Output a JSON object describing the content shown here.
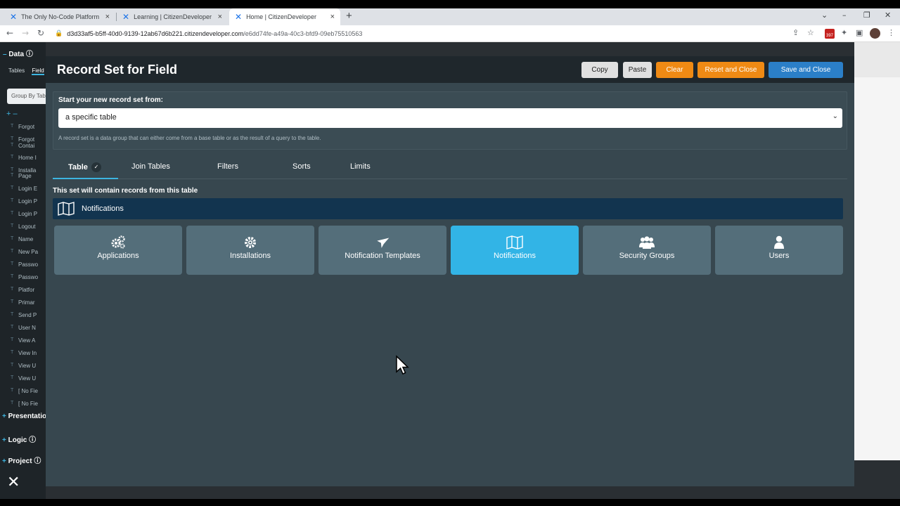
{
  "browser": {
    "tabs": [
      {
        "title": "The Only No-Code Platform For F"
      },
      {
        "title": "Learning | CitizenDeveloper"
      },
      {
        "title": "Home | CitizenDeveloper",
        "active": true
      }
    ],
    "url_host": "d3d33af5-b5ff-40d0-9139-12ab67d6b221.citizendeveloper.com",
    "url_path": "/e6dd74fe-a49a-40c3-bfd9-09eb75510563",
    "extension_badge": "397"
  },
  "left_panel": {
    "data_header": "Data",
    "tabs_label": "Tables",
    "fields_label": "Field",
    "group_by": "Group By Tab",
    "items": [
      "Forgot",
      "Forgot",
      "Contai",
      "Home I",
      "Installa",
      "Page",
      "Login E",
      "Login P",
      "Login P",
      "Logout",
      "Name",
      "New Pa",
      "Passwo",
      "Passwo",
      "Platfor",
      "Primar",
      "Send P",
      "User N",
      "View A",
      "View In",
      "View U",
      "View U",
      "[ No Fie",
      "[ No Fie"
    ],
    "presentation_label": "Presentatio",
    "logic_label": "Logic",
    "project_label": "Project"
  },
  "modal": {
    "title": "Record Set for Field",
    "buttons": {
      "copy": "Copy",
      "paste": "Paste",
      "clear": "Clear",
      "reset": "Reset and Close",
      "save": "Save and Close"
    },
    "source": {
      "label": "Start your new record set from:",
      "selected": "a specific table",
      "help": "A record set is a data group that can either come from a base table or as the result of a query to the table."
    },
    "tabs": [
      {
        "label": "Table",
        "active": true
      },
      {
        "label": "Join Tables"
      },
      {
        "label": "Filters"
      },
      {
        "label": "Sorts"
      },
      {
        "label": "Limits"
      }
    ],
    "contains_label": "This set will contain records from this table",
    "selected_table": "Notifications",
    "tables": [
      {
        "label": "Applications",
        "icon": "cogs-icon"
      },
      {
        "label": "Installations",
        "icon": "gear-icon"
      },
      {
        "label": "Notification Templates",
        "icon": "plane-icon"
      },
      {
        "label": "Notifications",
        "icon": "map-icon",
        "selected": true
      },
      {
        "label": "Security Groups",
        "icon": "users-icon"
      },
      {
        "label": "Users",
        "icon": "user-icon"
      }
    ]
  },
  "colors": {
    "accent": "#32b4e6",
    "orange": "#ef8a14",
    "save_blue": "#2b7fc8",
    "modal_bg": "#37474f",
    "card_bg": "#546e7a"
  }
}
